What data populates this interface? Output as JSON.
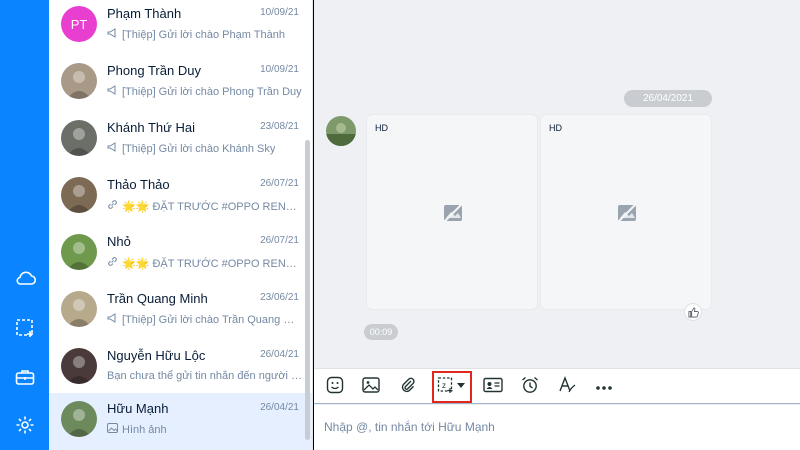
{
  "sidebar": {
    "items": [
      {
        "icon": "cloud-icon"
      },
      {
        "icon": "screenshot-capture-icon"
      },
      {
        "icon": "briefcase-icon"
      },
      {
        "icon": "settings-gear-icon"
      }
    ]
  },
  "conversations": [
    {
      "name": "Phạm Thành",
      "date": "10/09/21",
      "preview_icon": "megaphone-icon",
      "preview": "[Thiệp] Gửi lời chào Phạm Thành",
      "avatar_initials": "PT",
      "avatar_color": "#e83fd0",
      "active": false
    },
    {
      "name": "Phong Trần Duy",
      "date": "10/09/21",
      "preview_icon": "megaphone-icon",
      "preview": "[Thiệp] Gửi lời chào Phong Trần Duy",
      "avatar_initials": "",
      "avatar_color": "#a89a86",
      "active": false
    },
    {
      "name": "Khánh Thứ Hai",
      "date": "23/08/21",
      "preview_icon": "megaphone-icon",
      "preview": "[Thiệp] Gửi lời chào Khánh Sky",
      "avatar_initials": "",
      "avatar_color": "#6b6f68",
      "active": false
    },
    {
      "name": "Thảo Thảo",
      "date": "26/07/21",
      "preview_icon": "link-icon",
      "preview": "🌟🌟 ĐẶT TRƯỚC #OPPO RENO ...",
      "avatar_initials": "",
      "avatar_color": "#7c6a54",
      "active": false
    },
    {
      "name": "Nhỏ",
      "date": "26/07/21",
      "preview_icon": "link-icon",
      "preview": "🌟🌟 ĐẶT TRƯỚC #OPPO RENO ...",
      "avatar_initials": "",
      "avatar_color": "#6f9a4d",
      "active": false
    },
    {
      "name": "Trần Quang Minh",
      "date": "23/06/21",
      "preview_icon": "megaphone-icon",
      "preview": "[Thiệp] Gửi lời chào Trần Quang Mi...",
      "avatar_initials": "",
      "avatar_color": "#b7a98c",
      "active": false
    },
    {
      "name": "Nguyễn Hữu Lộc",
      "date": "26/04/21",
      "preview_icon": "",
      "preview": "Bạn chưa thể gửi tin nhắn đến người n...",
      "avatar_initials": "",
      "avatar_color": "#4a3a3a",
      "active": false
    },
    {
      "name": "Hữu Mạnh",
      "date": "26/04/21",
      "preview_icon": "image-icon",
      "preview": "Hình ảnh",
      "avatar_initials": "",
      "avatar_color": "#6d8a5c",
      "active": true
    }
  ],
  "chat": {
    "date_badge": "26/04/2021",
    "images": [
      {
        "badge": "HD"
      },
      {
        "badge": "HD"
      }
    ],
    "duration": "00:09",
    "toolbar": [
      {
        "name": "sticker-button",
        "icon": "sticker-icon"
      },
      {
        "name": "image-button",
        "icon": "image-icon"
      },
      {
        "name": "attach-file-button",
        "icon": "paperclip-icon"
      },
      {
        "name": "screenshot-button",
        "icon": "screenshot-icon",
        "highlight": true
      },
      {
        "name": "contact-card-button",
        "icon": "contact-card-icon"
      },
      {
        "name": "reminder-button",
        "icon": "alarm-clock-icon"
      },
      {
        "name": "text-format-button",
        "icon": "text-format-icon"
      },
      {
        "name": "more-button",
        "icon": "more-icon"
      }
    ],
    "input_placeholder": "Nhập @, tin nhắn tới Hữu Mạnh"
  },
  "colors": {
    "sidebar": "#0a84ff",
    "active_row": "#e5efff",
    "highlight_border": "#e0281f"
  }
}
